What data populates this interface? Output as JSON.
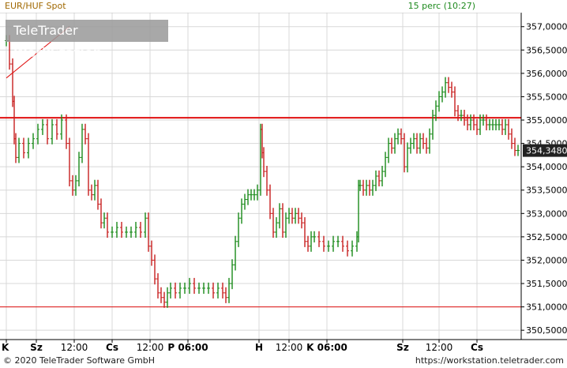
{
  "header": {
    "instrument": "EUR/HUF Spot",
    "status": "15 perc (10:27)"
  },
  "watermark": {
    "brand_regular": "TeleTrader ",
    "brand_bold": "WorkStation"
  },
  "footer": {
    "copyright": "© 2020 TeleTrader Software GmbH",
    "url": "https://workstation.teletrader.com"
  },
  "colors": {
    "up": "#1a8a1a",
    "down": "#c81e1e",
    "grid": "#d8d8d8",
    "line": "#e01010"
  },
  "chart_data": {
    "type": "line",
    "ylim": [
      350.3,
      357.3
    ],
    "y_ticks": [
      "357,0000",
      "356,5000",
      "356,0000",
      "355,5000",
      "355,0000",
      "354,5000",
      "354,0000",
      "353,5000",
      "353,0000",
      "352,5000",
      "352,0000",
      "351,5000",
      "351,0000",
      "350,5000"
    ],
    "y_tick_values": [
      357,
      356.5,
      356,
      355.5,
      355,
      354.5,
      354,
      353.5,
      353,
      352.5,
      352,
      351.5,
      351,
      350.5
    ],
    "x_ticks": [
      "K",
      "Sz",
      "12:00",
      "Cs",
      "12:00",
      "P 06:00",
      "H",
      "12:00",
      "K 06:00",
      "Sz",
      "12:00",
      "Cs"
    ],
    "x_tick_bold": [
      true,
      true,
      false,
      true,
      false,
      true,
      true,
      false,
      true,
      true,
      false,
      true
    ],
    "x_tick_pos": [
      0,
      38,
      86,
      134,
      182,
      230,
      320,
      358,
      406,
      502,
      548,
      596
    ],
    "last_price_label": "354,3480",
    "last_price": 354.348,
    "hlines": [
      355.05,
      351.0
    ],
    "trendline": {
      "x": [
        0,
        88
      ],
      "y": [
        355.9,
        357.0
      ]
    },
    "series": [
      {
        "x": [
          0,
          4,
          8,
          10,
          12,
          16,
          22,
          28,
          34,
          40,
          46,
          52,
          58,
          64,
          70,
          76,
          80,
          84,
          88,
          92,
          96,
          100,
          104,
          108,
          112,
          116,
          120,
          124,
          128,
          134,
          140,
          146,
          152,
          158,
          164,
          170,
          176,
          180,
          184,
          188,
          192,
          196,
          200,
          204,
          208,
          214,
          220,
          226,
          232,
          238,
          244,
          250,
          256,
          262,
          268,
          274,
          278,
          282,
          286,
          290,
          294,
          298,
          302,
          306,
          310,
          314,
          318,
          322,
          324,
          326,
          330,
          334,
          338,
          342,
          346,
          350,
          354,
          358,
          362,
          366,
          370,
          374,
          378,
          382,
          386,
          390,
          396,
          402,
          408,
          414,
          420,
          426,
          432,
          438,
          444,
          446,
          448,
          452,
          456,
          460,
          464,
          468,
          472,
          476,
          480,
          484,
          488,
          492,
          496,
          500,
          504,
          508,
          512,
          516,
          520,
          524,
          528,
          532,
          536,
          540,
          544,
          548,
          552,
          556,
          560,
          564,
          568,
          572,
          576,
          580,
          584,
          588,
          592,
          596,
          600,
          604,
          608,
          612,
          616,
          620,
          624,
          628,
          632,
          636,
          640,
          644,
          648
        ],
        "y": [
          356.7,
          356.2,
          355.4,
          354.6,
          354.2,
          354.5,
          354.3,
          354.5,
          354.6,
          354.8,
          354.9,
          354.6,
          354.9,
          354.7,
          355.0,
          354.5,
          353.7,
          353.5,
          353.7,
          354.2,
          354.8,
          354.6,
          353.5,
          353.4,
          353.6,
          353.2,
          352.8,
          352.9,
          352.6,
          352.6,
          352.7,
          352.6,
          352.6,
          352.6,
          352.7,
          352.6,
          352.9,
          352.3,
          352.0,
          351.6,
          351.3,
          351.2,
          351.1,
          351.3,
          351.4,
          351.3,
          351.4,
          351.4,
          351.5,
          351.4,
          351.4,
          351.4,
          351.4,
          351.3,
          351.4,
          351.3,
          351.2,
          351.5,
          351.9,
          352.4,
          352.9,
          353.2,
          353.3,
          353.4,
          353.4,
          353.4,
          353.5,
          354.8,
          354.3,
          353.9,
          353.5,
          353.0,
          352.6,
          352.8,
          353.1,
          352.6,
          352.9,
          353.0,
          352.9,
          353.0,
          352.9,
          352.8,
          352.4,
          352.3,
          352.5,
          352.5,
          352.4,
          352.3,
          352.3,
          352.4,
          352.4,
          352.3,
          352.2,
          352.3,
          352.5,
          353.6,
          353.6,
          353.5,
          353.6,
          353.5,
          353.6,
          353.8,
          353.7,
          353.9,
          354.2,
          354.5,
          354.4,
          354.6,
          354.7,
          354.6,
          354.0,
          354.4,
          354.5,
          354.6,
          354.4,
          354.6,
          354.5,
          354.4,
          354.7,
          355.1,
          355.3,
          355.5,
          355.6,
          355.8,
          355.7,
          355.6,
          355.2,
          355.1,
          355.1,
          355.0,
          354.9,
          355.0,
          354.9,
          354.8,
          355.0,
          355.0,
          354.9,
          354.9,
          354.9,
          354.9,
          354.9,
          354.8,
          354.9,
          354.7,
          354.5,
          354.35,
          354.35
        ]
      }
    ]
  }
}
